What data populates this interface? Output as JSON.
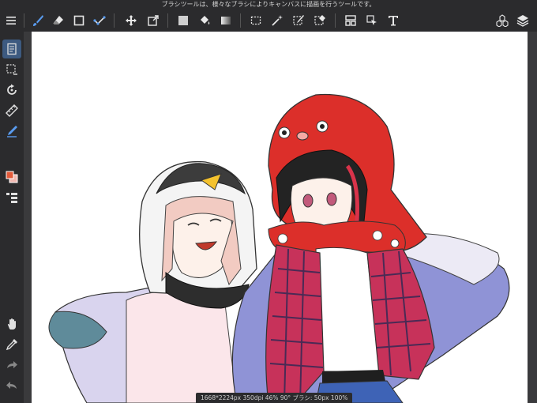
{
  "hint_text": "ブラシツールは、様々なブラシによりキャンバスに描画を行うツールです。",
  "status_text": "1668*2224px 350dpi 46% 90° ブラシ: 50px 100%",
  "colors": {
    "accent": "#3d7be0",
    "toolbar_bg": "#2b2b2d",
    "canvas_bg": "#ffffff"
  },
  "toolbar_icons": [
    "menu-icon",
    "brush-icon",
    "eraser-icon",
    "rect-icon",
    "dot-icon",
    "move-icon",
    "transform-icon",
    "fill-color-icon",
    "bucket-icon",
    "gradient-icon",
    "select-rect-icon",
    "magic-wand-icon",
    "select-pen-icon",
    "select-eraser-icon",
    "layout-icon",
    "select-cursor-icon",
    "text-icon",
    "materials-icon",
    "layers-icon"
  ],
  "sidebar_icons": [
    "page-icon",
    "selection-icon",
    "rotate-icon",
    "ruler-icon",
    "pen-icon",
    "color-swatch-icon",
    "layer-list-icon",
    "hand-icon",
    "eyedropper-icon",
    "redo-icon",
    "undo-icon"
  ]
}
